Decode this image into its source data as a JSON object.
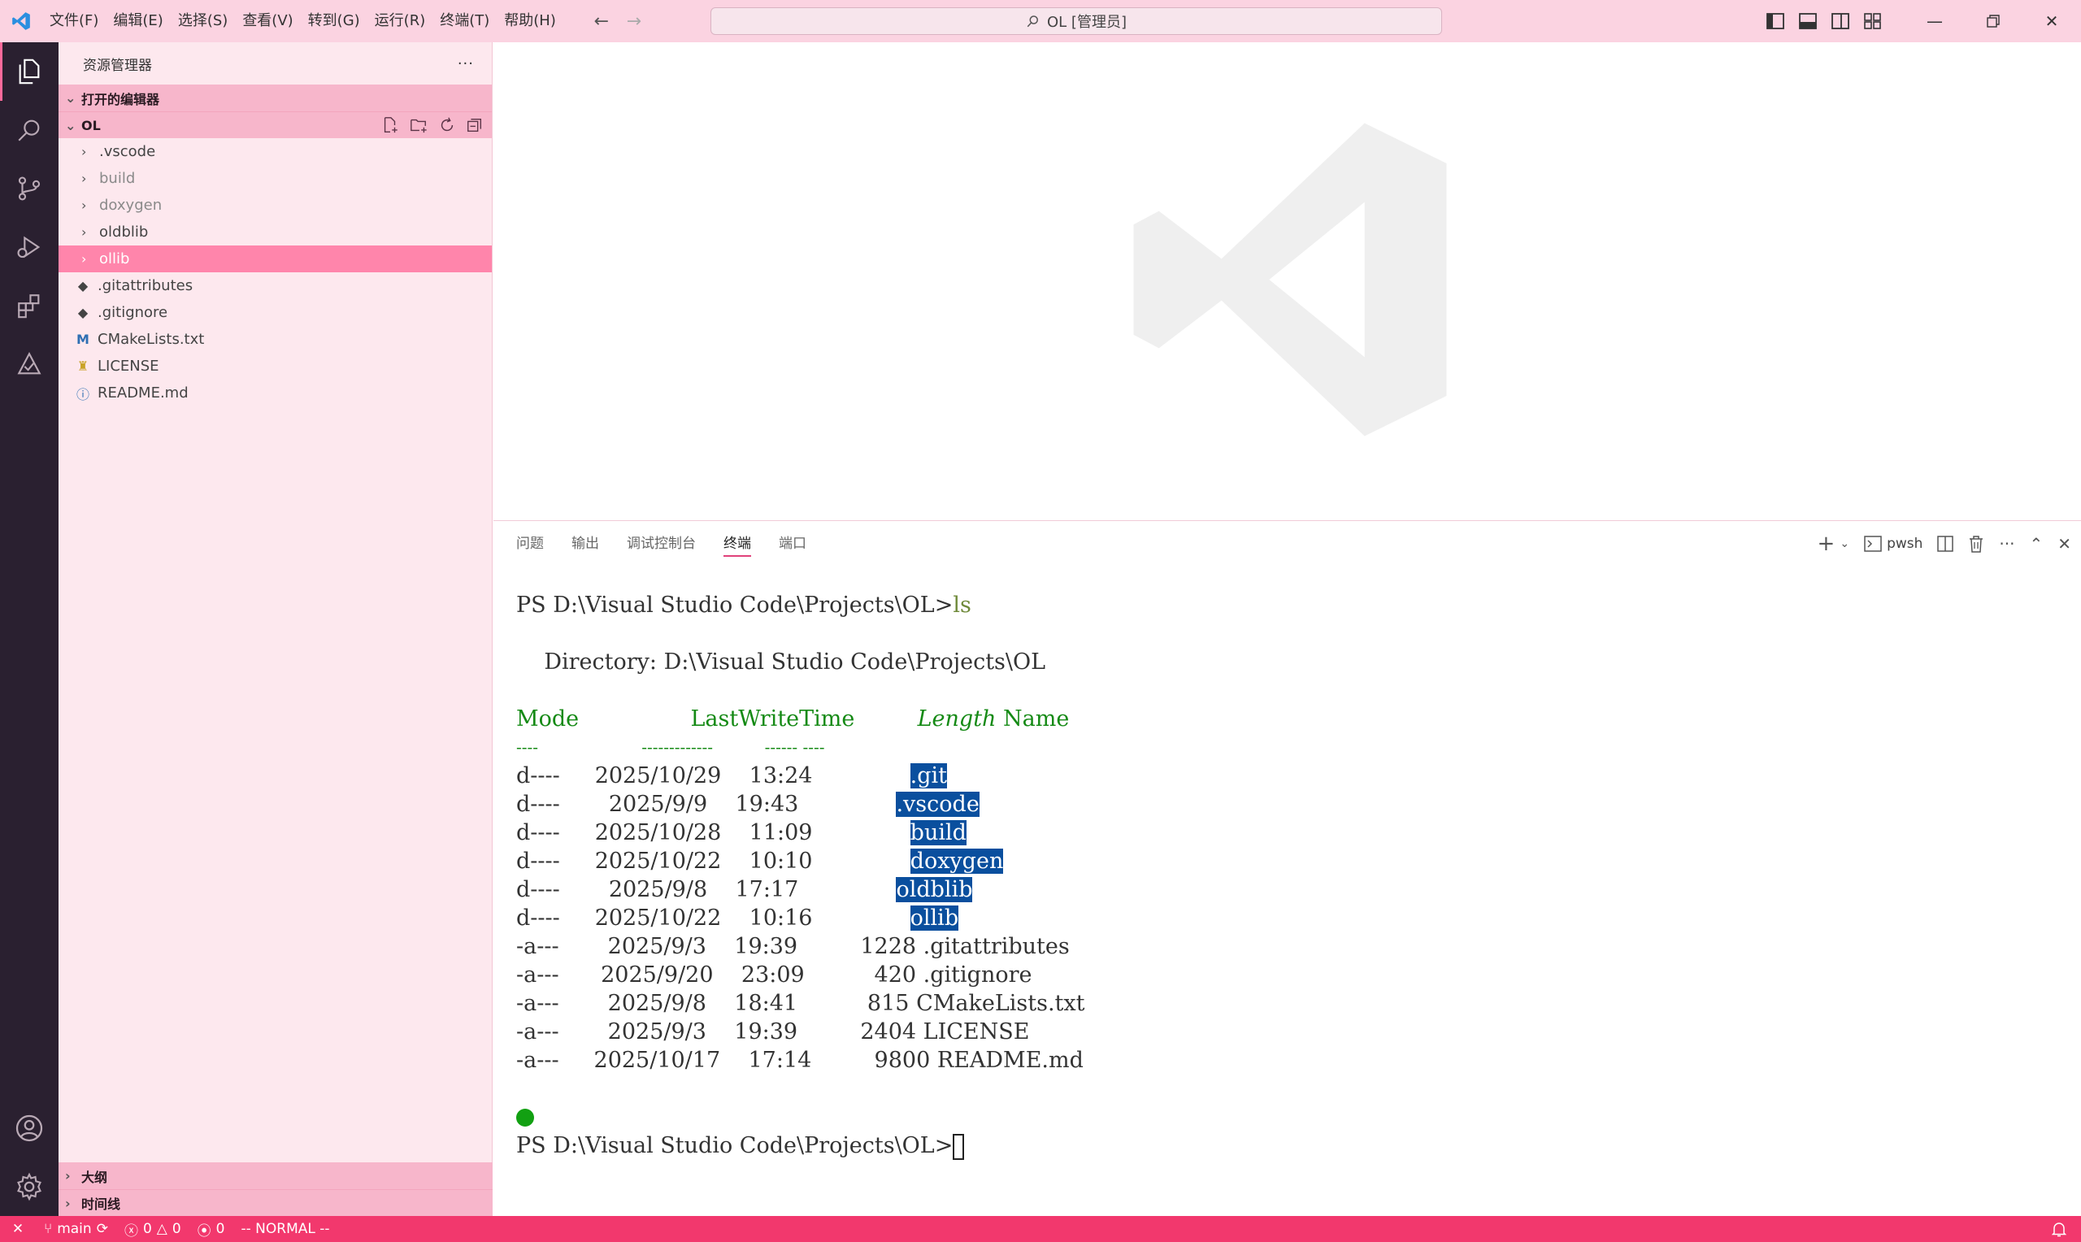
{
  "colors": {
    "accent": "#f2386d",
    "titlebar": "#fbd3e1",
    "sidebar": "#fde8ee",
    "selection": "#ff85ab",
    "activitybar": "#2a2030",
    "terminal_green": "#158a15",
    "terminal_highlight": "#0a4f9e"
  },
  "menu": [
    "文件(F)",
    "编辑(E)",
    "选择(S)",
    "查看(V)",
    "转到(G)",
    "运行(R)",
    "终端(T)",
    "帮助(H)"
  ],
  "command_center": {
    "text": "OL [管理员]",
    "icon": "search-icon"
  },
  "activity_bar": {
    "top": [
      "explorer-icon",
      "search-icon",
      "source-control-icon",
      "run-debug-icon",
      "extensions-icon",
      "testing-icon"
    ],
    "bottom": [
      "accounts-icon",
      "settings-gear-icon"
    ]
  },
  "sidebar": {
    "title": "资源管理器",
    "more": "···",
    "open_editors": "打开的编辑器",
    "folder": "OL",
    "items": [
      {
        "label": ".vscode",
        "type": "folder"
      },
      {
        "label": "build",
        "type": "folder"
      },
      {
        "label": "doxygen",
        "type": "folder"
      },
      {
        "label": "oldblib",
        "type": "folder"
      },
      {
        "label": "ollib",
        "type": "folder"
      },
      {
        "label": ".gitattributes",
        "type": "file"
      },
      {
        "label": ".gitignore",
        "type": "file"
      },
      {
        "label": "CMakeLists.txt",
        "type": "file"
      },
      {
        "label": "LICENSE",
        "type": "file"
      },
      {
        "label": "README.md",
        "type": "file"
      }
    ],
    "outline": "大纲",
    "timeline": "时间线"
  },
  "panel": {
    "tabs": [
      "问题",
      "输出",
      "调试控制台",
      "终端",
      "端口"
    ],
    "active_tab": "终端",
    "shell": "pwsh"
  },
  "terminal": {
    "prompt": "PS D:\\Visual Studio Code\\Projects\\OL>",
    "command": "ls",
    "directory_line": "    Directory: D:\\Visual Studio Code\\Projects\\OL",
    "headers": {
      "mode": "Mode",
      "time": "LastWriteTime",
      "length": "Length",
      "name": "Name"
    },
    "underlines": {
      "mode": "----",
      "time": "-------------",
      "length": "------",
      "name": "----"
    },
    "rows": [
      {
        "mode": "d----",
        "date": "2025/10/29",
        "time": "13:24",
        "length": "",
        "name": ".git"
      },
      {
        "mode": "d----",
        "date": "2025/9/9",
        "time": "19:43",
        "length": "",
        "name": ".vscode"
      },
      {
        "mode": "d----",
        "date": "2025/10/28",
        "time": "11:09",
        "length": "",
        "name": "build"
      },
      {
        "mode": "d----",
        "date": "2025/10/22",
        "time": "10:10",
        "length": "",
        "name": "doxygen"
      },
      {
        "mode": "d----",
        "date": "2025/9/8",
        "time": "17:17",
        "length": "",
        "name": "oldblib"
      },
      {
        "mode": "d----",
        "date": "2025/10/22",
        "time": "10:16",
        "length": "",
        "name": "ollib"
      },
      {
        "mode": "-a---",
        "date": "2025/9/3",
        "time": "19:39",
        "length": "1228",
        "name": ".gitattributes"
      },
      {
        "mode": "-a---",
        "date": "2025/9/20",
        "time": "23:09",
        "length": "420",
        "name": ".gitignore"
      },
      {
        "mode": "-a---",
        "date": "2025/9/8",
        "time": "18:41",
        "length": "815",
        "name": "CMakeLists.txt"
      },
      {
        "mode": "-a---",
        "date": "2025/9/3",
        "time": "19:39",
        "length": "2404",
        "name": "LICENSE"
      },
      {
        "mode": "-a---",
        "date": "2025/10/17",
        "time": "17:14",
        "length": "9800",
        "name": "README.md"
      }
    ]
  },
  "statusbar": {
    "branch": "main",
    "errors": "0",
    "warnings": "0",
    "ports": "0",
    "mode": "-- NORMAL --"
  }
}
